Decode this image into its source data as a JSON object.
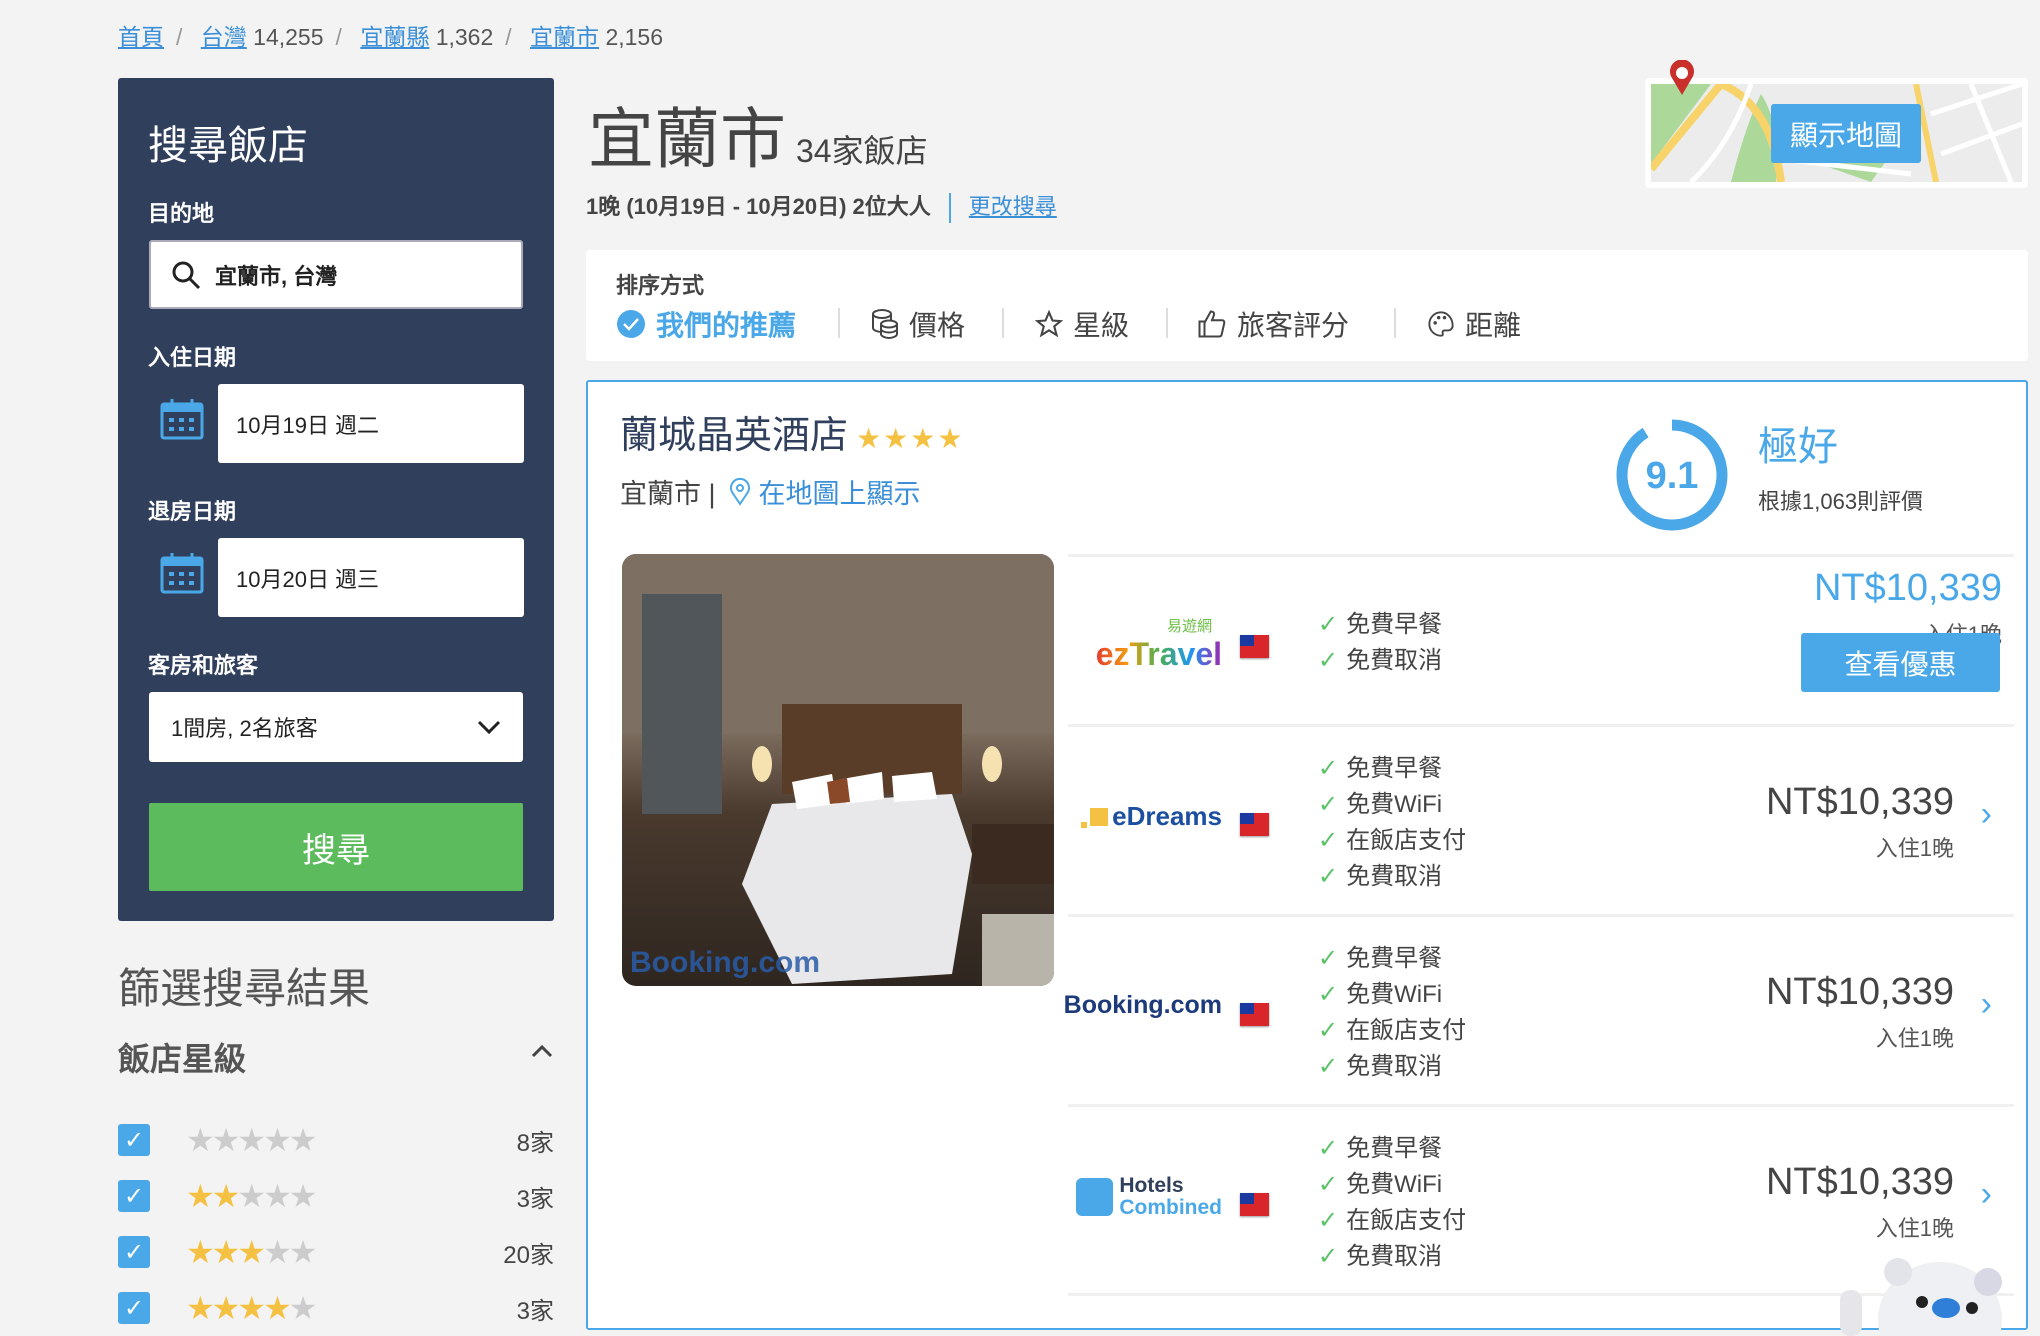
{
  "breadcrumb": [
    {
      "label": "首頁",
      "count": ""
    },
    {
      "label": "台灣",
      "count": "14,255"
    },
    {
      "label": "宜蘭縣",
      "count": "1,362"
    },
    {
      "label": "宜蘭市",
      "count": "2,156"
    }
  ],
  "sidebar": {
    "title": "搜尋飯店",
    "destination_label": "目的地",
    "destination_value": "宜蘭市, 台灣",
    "checkin_label": "入住日期",
    "checkin_value": "10月19日 週二",
    "checkout_label": "退房日期",
    "checkout_value": "10月20日 週三",
    "rooms_label": "客房和旅客",
    "rooms_value": "1間房, 2名旅客",
    "search_button": "搜尋"
  },
  "filters": {
    "title": "篩選搜尋結果",
    "star_section": "飯店星級",
    "rows": [
      {
        "stars": 0,
        "count": "8家",
        "checked": true
      },
      {
        "stars": 2,
        "count": "3家",
        "checked": true
      },
      {
        "stars": 3,
        "count": "20家",
        "checked": true
      },
      {
        "stars": 4,
        "count": "3家",
        "checked": true
      }
    ]
  },
  "header": {
    "city": "宜蘭市",
    "hotel_count": "34家飯店",
    "summary": "1晚 (10月19日 - 10月20日) 2位大人",
    "change_search": "更改搜尋",
    "map_button": "顯示地圖"
  },
  "sort": {
    "label": "排序方式",
    "options": [
      {
        "label": "我們的推薦",
        "icon": "check-circle-icon",
        "active": true
      },
      {
        "label": "價格",
        "icon": "coins-icon"
      },
      {
        "label": "星級",
        "icon": "star-icon"
      },
      {
        "label": "旅客評分",
        "icon": "thumbs-up-icon"
      },
      {
        "label": "距離",
        "icon": "palette-icon"
      }
    ]
  },
  "hotel": {
    "name": "蘭城晶英酒店",
    "stars": 4,
    "city": "宜蘭市 |",
    "map_link": "在地圖上顯示",
    "rating": "9.1",
    "rating_word": "極好",
    "rating_count": "根據1,063則評價",
    "photo_watermark": "Booking.com",
    "offers": [
      {
        "provider": "ezTravel",
        "provider_sub": "易遊網",
        "features": [
          "免費早餐",
          "免費取消"
        ],
        "price": "NT$10,339",
        "night": "入住1晚",
        "button": "查看優惠"
      },
      {
        "provider": "eDreams",
        "features": [
          "免費早餐",
          "免費WiFi",
          "在飯店支付",
          "免費取消"
        ],
        "price": "NT$10,339",
        "night": "入住1晚"
      },
      {
        "provider": "Booking.com",
        "features": [
          "免費早餐",
          "免費WiFi",
          "在飯店支付",
          "免費取消"
        ],
        "price": "NT$10,339",
        "night": "入住1晚"
      },
      {
        "provider": "Hotels Combined",
        "provider_l1": "Hotels",
        "provider_l2": "Combined",
        "features": [
          "免費早餐",
          "免費WiFi",
          "在飯店支付",
          "免費取消"
        ],
        "price": "NT$10,339",
        "night": "入住1晚"
      }
    ]
  },
  "colors": {
    "accent": "#4aa8e8",
    "sidebar": "#2f3f5c",
    "search_button": "#5cbb5c",
    "star": "#f5c142"
  }
}
